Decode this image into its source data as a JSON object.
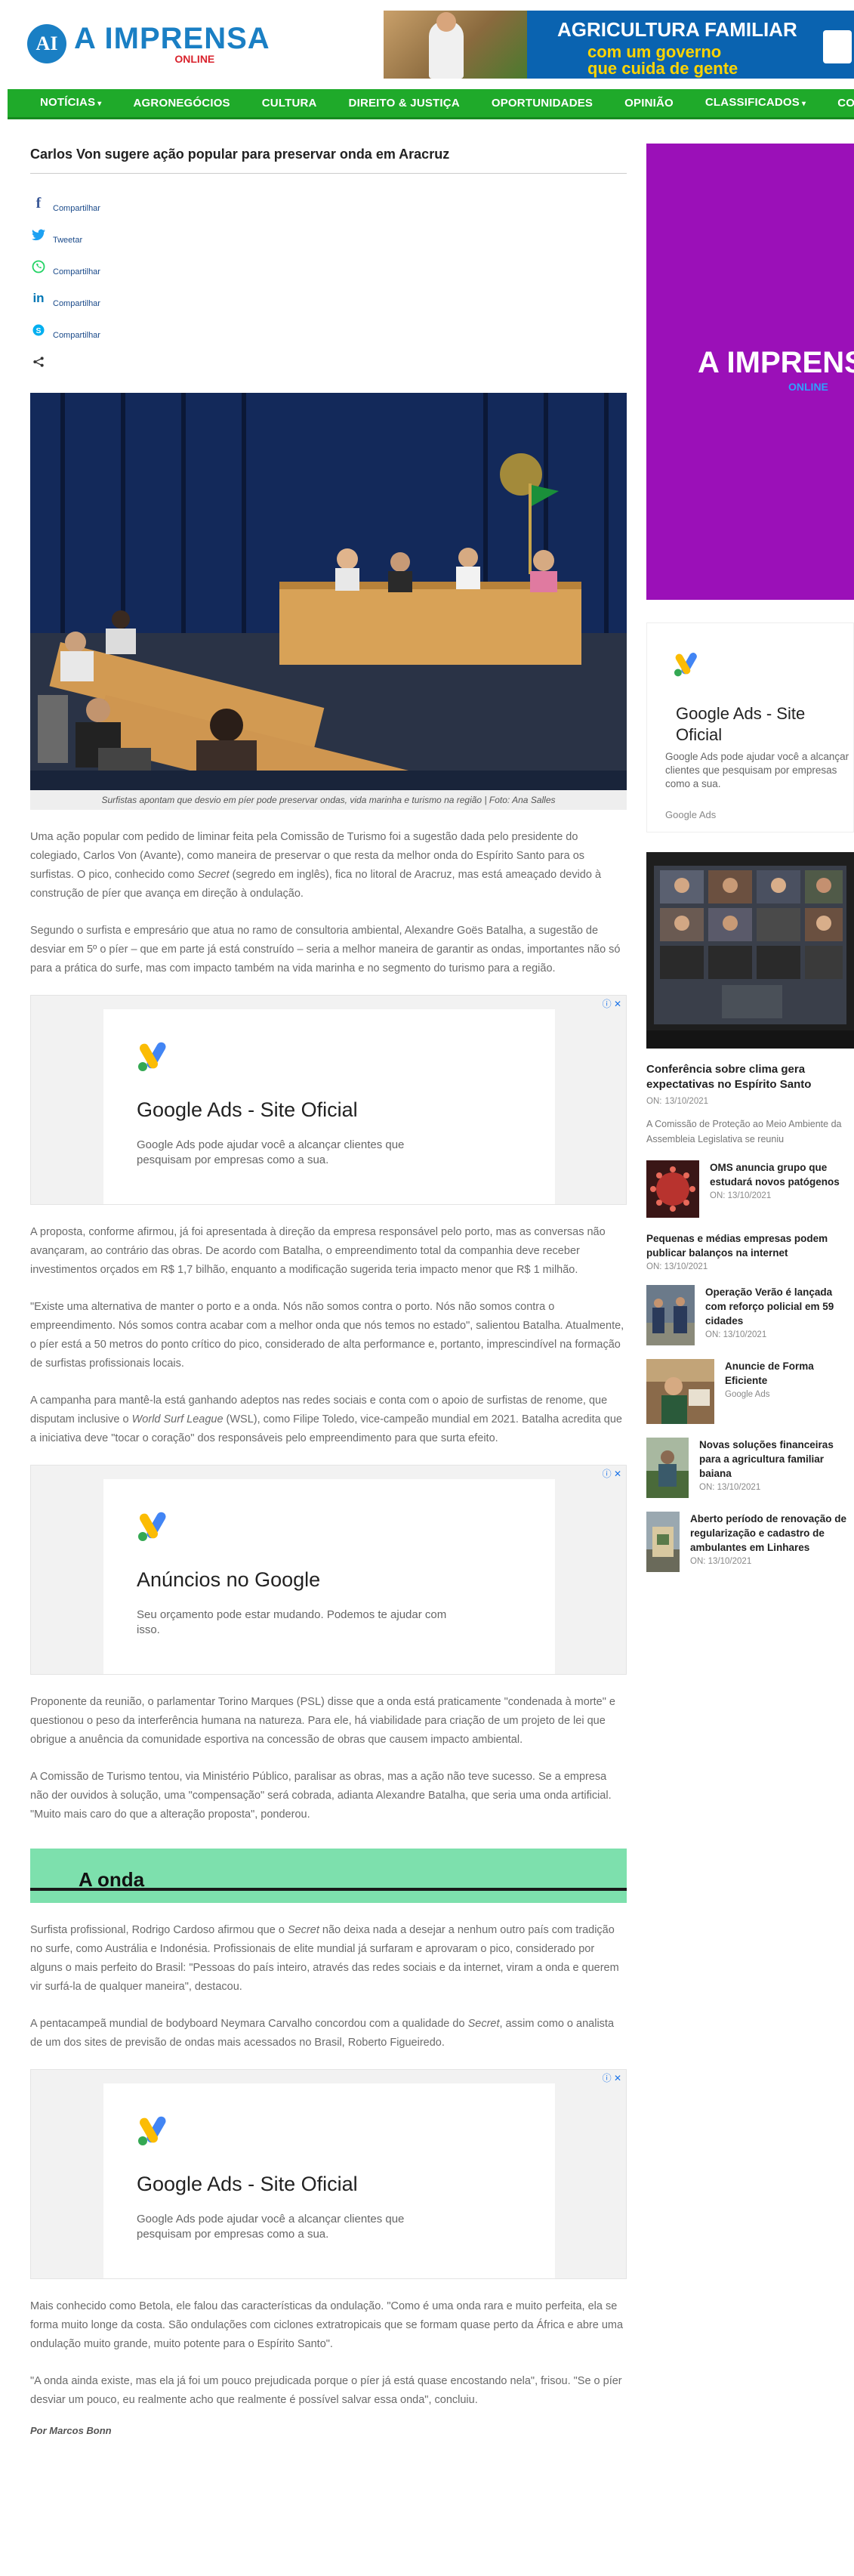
{
  "site": {
    "logo_badge": "AI",
    "logo_main": "A IMPRENSA",
    "logo_sub": "ONLINE"
  },
  "top_banner": {
    "title": "AGRICULTURA FAMILIAR",
    "line1": "com um governo",
    "line2": "que cuida de gente"
  },
  "nav": {
    "items": [
      {
        "label": "NOTÍCIAS",
        "has_dropdown": true
      },
      {
        "label": "AGRONEGÓCIOS",
        "has_dropdown": false
      },
      {
        "label": "CULTURA",
        "has_dropdown": false
      },
      {
        "label": "DIREITO & JUSTIÇA",
        "has_dropdown": false
      },
      {
        "label": "OPORTUNIDADES",
        "has_dropdown": false
      },
      {
        "label": "OPINIÃO",
        "has_dropdown": false
      },
      {
        "label": "CLASSIFICADOS",
        "has_dropdown": true
      },
      {
        "label": "CONTATO",
        "has_dropdown": false
      }
    ],
    "caret": "▾"
  },
  "article": {
    "title": "Carlos Von sugere ação popular para preservar onda em Aracruz",
    "share": [
      {
        "icon": "facebook-icon",
        "glyph": "f",
        "label": "Compartilhar",
        "color": "#3b5998"
      },
      {
        "icon": "twitter-icon",
        "glyph": "🐦",
        "label": "Tweetar",
        "color": "#1da1f2"
      },
      {
        "icon": "whatsapp-icon",
        "glyph": "✆",
        "label": "Compartilhar",
        "color": "#25d366"
      },
      {
        "icon": "linkedin-icon",
        "glyph": "in",
        "label": "Compartilhar",
        "color": "#0077b5"
      },
      {
        "icon": "skype-icon",
        "glyph": "S",
        "label": "Compartilhar",
        "color": "#00aff0"
      },
      {
        "icon": "share-icon",
        "glyph": "⋖",
        "label": "",
        "color": "#333333"
      }
    ],
    "caption": "Surfistas apontam que desvio em píer pode preservar ondas, vida marinha e turismo na região | Foto: Ana Salles",
    "p1": "Uma ação popular com pedido de liminar feita pela Comissão de Turismo foi a sugestão dada pelo presidente do colegiado, Carlos Von (Avante), como maneira de preservar o que resta da melhor onda do Espírito Santo para os surfistas. O pico, conhecido como",
    "p1_em": "Secret",
    "p1_end": "(segredo em inglês), fica no litoral de Aracruz, mas está ameaçado devido à construção de píer que avança em direção à ondulação.",
    "p2": "Segundo o surfista e empresário que atua no ramo de consultoria ambiental, Alexandre Goës Batalha, a sugestão de desviar em 5º o píer – que em parte já está construído – seria a melhor maneira de garantir as ondas, importantes não só para a prática do surfe, mas com impacto também na vida marinha e no segmento do turismo para a região.",
    "p3": "A proposta, conforme afirmou, já foi apresentada à direção da empresa responsável pelo porto, mas as conversas não avançaram, ao contrário das obras. De acordo com Batalha, o empreendimento total da companhia deve receber investimentos orçados em R$ 1,7 bilhão, enquanto a modificação sugerida teria impacto menor que R$ 1 milhão.",
    "p4": "\"Existe uma alternativa de manter o porto e a onda. Nós não somos contra o porto. Nós não somos contra o empreendimento. Nós somos contra acabar com a melhor onda que nós temos no estado\", salientou Batalha. Atualmente, o píer está a 50 metros do ponto crítico do pico, considerado de alta performance e, portanto, imprescindível na formação de surfistas profissionais locais.",
    "p5": "A campanha para mantê-la está ganhando adeptos nas redes sociais e conta com o apoio de surfistas de renome, que disputam inclusive o",
    "p5_em": "World Surf League",
    "p5_end": "(WSL), como Filipe Toledo, vice-campeão mundial em 2021. Batalha acredita que a iniciativa deve \"tocar o coração\" dos responsáveis pelo empreendimento para que surta efeito.",
    "p6": "Proponente da reunião, o parlamentar Torino Marques (PSL) disse que a onda está praticamente \"condenada à morte\" e questionou o peso da interferência humana na natureza. Para ele, há viabilidade para criação de um projeto de lei que obrigue a anuência da comunidade esportiva na concessão de obras que causem impacto ambiental.",
    "p7": "A Comissão de Turismo tentou, via Ministério Público, paralisar as obras, mas a ação não teve sucesso. Se a empresa não der ouvidos à solução, uma \"compensação\" será cobrada, adianta Alexandre Batalha, que seria uma onda artificial. \"Muito mais caro do que a alteração proposta\", ponderou.",
    "section_title": "A onda",
    "p8": "Surfista profissional, Rodrigo Cardoso afirmou que o",
    "p8_em": "Secret",
    "p8_end": "não deixa nada a desejar a nenhum outro país com tradição no surfe, como Austrália e Indonésia. Profissionais de elite mundial já surfaram e aprovaram o pico, considerado por alguns o mais perfeito do Brasil: \"Pessoas do país inteiro, através das redes sociais e da internet, viram a onda e querem vir surfá-la de qualquer maneira\", destacou.",
    "p9": "A pentacampeã mundial de bodyboard Neymara Carvalho concordou com a qualidade do",
    "p9_em": "Secret",
    "p9_end": ", assim como o analista de um dos sites de previsão de ondas mais acessados no Brasil, Roberto Figueiredo.",
    "p10": "Mais conhecido como Betola, ele falou das características da ondulação. \"Como é uma onda rara e muito perfeita, ela se forma muito longe da costa. São ondulações com ciclones extratropicais que se formam quase perto da África e abre uma ondulação muito grande, muito potente para o Espírito Santo\".",
    "p11": "\"A onda ainda existe, mas ela já foi um pouco prejudicada porque o píer já está quase encostando nela\", frisou. \"Se o píer desviar um pouco, eu realmente acho que realmente é possível salvar essa onda\", concluiu.",
    "byline": "Por Marcos Bonn"
  },
  "ads": [
    {
      "title": "Google Ads - Site Oficial",
      "desc": "Google Ads pode ajudar você a alcançar clientes que pesquisam por empresas como a sua.",
      "corner": "ⓘ ✕"
    },
    {
      "title": "Anúncios no Google",
      "desc": "Seu orçamento pode estar mudando. Podemos te ajudar com isso.",
      "corner": "ⓘ ✕"
    },
    {
      "title": "Google Ads - Site Oficial",
      "desc": "Google Ads pode ajudar você a alcançar clientes que pesquisam por empresas como a sua.",
      "corner": "ⓘ ✕"
    }
  ],
  "sidebar": {
    "banner_main": "A IMPRENSA",
    "banner_sub": "ONLINE",
    "ad": {
      "title_line1": "Google Ads - Site",
      "title_line2": "Oficial",
      "desc": "Google Ads pode ajudar você a alcançar clientes que pesquisam por empresas como a sua.",
      "src": "Google Ads"
    },
    "featured": {
      "title": "Conferência sobre clima gera expectativas no Espírito Santo",
      "date_label": "ON:",
      "date": "13/10/2021",
      "desc": "A Comissão de Proteção ao Meio Ambiente da Assembleia Legislativa se reuniu"
    },
    "items": [
      {
        "title": "OMS anuncia grupo que estudará novos patógenos",
        "date_label": "ON:",
        "date": "13/10/2021",
        "thumb": "virus"
      },
      {
        "title": "Pequenas e médias empresas podem publicar balanços na internet",
        "date_label": "ON:",
        "date": "13/10/2021",
        "thumb": ""
      },
      {
        "title": "Operação Verão é lançada com reforço policial em 59 cidades",
        "date_label": "ON:",
        "date": "13/10/2021",
        "thumb": "police"
      },
      {
        "title": "Anuncie de Forma Eficiente",
        "date_label": "",
        "date": "Google Ads",
        "thumb": "ads"
      },
      {
        "title": "Novas soluções financeiras para a agricultura familiar baiana",
        "date_label": "ON:",
        "date": "13/10/2021",
        "thumb": "farm"
      },
      {
        "title": "Aberto período de renovação de regularização e cadastro de ambulantes em Linhares",
        "date_label": "ON:",
        "date": "13/10/2021",
        "thumb": "street"
      }
    ]
  }
}
